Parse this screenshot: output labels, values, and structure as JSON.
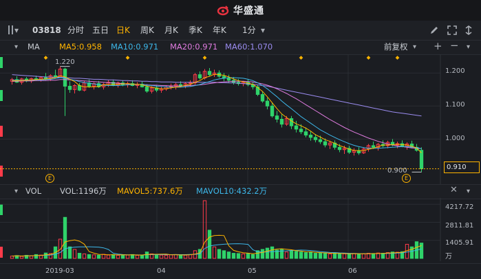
{
  "app": {
    "logo_text": "华盛通"
  },
  "toolbar": {
    "stock_code": "03818",
    "periods": [
      "分时",
      "五日",
      "日K",
      "周K",
      "月K",
      "季K",
      "年K",
      "1分"
    ],
    "active_period": "日K"
  },
  "main_chart": {
    "label": "MA",
    "ma5": "MA5:0.958",
    "ma10": "MA10:0.971",
    "ma20": "MA20:0.971",
    "ma60": "MA60:1.070",
    "adjust": "前复权",
    "price_ticks": [
      "1.200",
      "1.100",
      "1.000"
    ],
    "current_price": "0.910",
    "high_label": "1.220",
    "low_label": "0.900",
    "event_marker": "E"
  },
  "volume_chart": {
    "label": "VOL",
    "vol": "VOL:1196万",
    "mavol5": "MAVOL5:737.6万",
    "mavol10": "MAVOL10:432.2万",
    "ticks": [
      "4217.72",
      "2811.81",
      "1405.91"
    ],
    "unit": "万"
  },
  "x_axis": {
    "labels": [
      "2019-03",
      "04",
      "05",
      "06"
    ]
  },
  "colors": {
    "up": "#ff3b4a",
    "down": "#2fd36a",
    "ma5": "#ffb400",
    "ma10": "#3db7e9",
    "ma20": "#e07ce0",
    "ma60": "#9b8cf0",
    "accent": "#ffb400"
  },
  "chart_data": {
    "type": "candlestick",
    "ylim": [
      0.88,
      1.24
    ],
    "vol_ylim": [
      0,
      4500
    ],
    "ohlc": [
      [
        1.175,
        1.185,
        1.165,
        1.18
      ],
      [
        1.18,
        1.19,
        1.17,
        1.172
      ],
      [
        1.172,
        1.185,
        1.165,
        1.182
      ],
      [
        1.182,
        1.188,
        1.172,
        1.176
      ],
      [
        1.176,
        1.186,
        1.17,
        1.183
      ],
      [
        1.183,
        1.192,
        1.176,
        1.18
      ],
      [
        1.18,
        1.19,
        1.174,
        1.186
      ],
      [
        1.186,
        1.2,
        1.178,
        1.182
      ],
      [
        1.182,
        1.196,
        1.176,
        1.192
      ],
      [
        1.192,
        1.21,
        1.185,
        1.188
      ],
      [
        1.188,
        1.22,
        1.185,
        1.212
      ],
      [
        1.212,
        1.216,
        1.07,
        1.16
      ],
      [
        1.16,
        1.175,
        1.14,
        1.15
      ],
      [
        1.15,
        1.166,
        1.138,
        1.162
      ],
      [
        1.162,
        1.17,
        1.145,
        1.148
      ],
      [
        1.148,
        1.176,
        1.144,
        1.17
      ],
      [
        1.17,
        1.18,
        1.155,
        1.16
      ],
      [
        1.16,
        1.172,
        1.15,
        1.168
      ],
      [
        1.168,
        1.176,
        1.155,
        1.158
      ],
      [
        1.158,
        1.17,
        1.15,
        1.165
      ],
      [
        1.165,
        1.178,
        1.158,
        1.172
      ],
      [
        1.172,
        1.18,
        1.16,
        1.163
      ],
      [
        1.163,
        1.174,
        1.156,
        1.17
      ],
      [
        1.17,
        1.178,
        1.16,
        1.164
      ],
      [
        1.164,
        1.174,
        1.156,
        1.168
      ],
      [
        1.168,
        1.178,
        1.16,
        1.162
      ],
      [
        1.162,
        1.172,
        1.154,
        1.166
      ],
      [
        1.166,
        1.174,
        1.156,
        1.158
      ],
      [
        1.158,
        1.166,
        1.14,
        1.145
      ],
      [
        1.145,
        1.16,
        1.138,
        1.155
      ],
      [
        1.155,
        1.162,
        1.142,
        1.148
      ],
      [
        1.148,
        1.158,
        1.14,
        1.152
      ],
      [
        1.152,
        1.162,
        1.146,
        1.158
      ],
      [
        1.158,
        1.168,
        1.15,
        1.16
      ],
      [
        1.16,
        1.17,
        1.15,
        1.165
      ],
      [
        1.165,
        1.175,
        1.158,
        1.162
      ],
      [
        1.162,
        1.172,
        1.154,
        1.168
      ],
      [
        1.168,
        1.178,
        1.16,
        1.17
      ],
      [
        1.17,
        1.2,
        1.165,
        1.195
      ],
      [
        1.195,
        1.205,
        1.18,
        1.185
      ],
      [
        1.185,
        1.212,
        1.18,
        1.205
      ],
      [
        1.205,
        1.215,
        1.19,
        1.195
      ],
      [
        1.195,
        1.21,
        1.188,
        1.2
      ],
      [
        1.2,
        1.208,
        1.185,
        1.19
      ],
      [
        1.19,
        1.2,
        1.175,
        1.185
      ],
      [
        1.185,
        1.195,
        1.17,
        1.178
      ],
      [
        1.178,
        1.188,
        1.165,
        1.172
      ],
      [
        1.172,
        1.182,
        1.162,
        1.168
      ],
      [
        1.168,
        1.176,
        1.16,
        1.172
      ],
      [
        1.172,
        1.18,
        1.16,
        1.165
      ],
      [
        1.165,
        1.172,
        1.15,
        1.158
      ],
      [
        1.158,
        1.165,
        1.13,
        1.135
      ],
      [
        1.135,
        1.145,
        1.11,
        1.115
      ],
      [
        1.115,
        1.125,
        1.09,
        1.1
      ],
      [
        1.1,
        1.11,
        1.065,
        1.07
      ],
      [
        1.07,
        1.085,
        1.05,
        1.06
      ],
      [
        1.06,
        1.075,
        1.035,
        1.045
      ],
      [
        1.045,
        1.07,
        1.04,
        1.062
      ],
      [
        1.062,
        1.07,
        1.03,
        1.04
      ],
      [
        1.04,
        1.055,
        1.02,
        1.03
      ],
      [
        1.03,
        1.045,
        1.015,
        1.022
      ],
      [
        1.022,
        1.035,
        1.005,
        1.012
      ],
      [
        1.012,
        1.025,
        0.995,
        1.005
      ],
      [
        1.005,
        1.015,
        0.99,
        0.998
      ],
      [
        0.998,
        1.01,
        0.985,
        0.992
      ],
      [
        0.992,
        1.002,
        0.975,
        0.982
      ],
      [
        0.982,
        0.995,
        0.97,
        0.988
      ],
      [
        0.988,
        0.996,
        0.968,
        0.975
      ],
      [
        0.975,
        0.985,
        0.96,
        0.968
      ],
      [
        0.968,
        0.98,
        0.955,
        0.972
      ],
      [
        0.972,
        0.98,
        0.955,
        0.96
      ],
      [
        0.96,
        0.972,
        0.95,
        0.965
      ],
      [
        0.965,
        0.975,
        0.952,
        0.958
      ],
      [
        0.958,
        0.975,
        0.955,
        0.97
      ],
      [
        0.97,
        0.985,
        0.962,
        0.98
      ],
      [
        0.98,
        0.992,
        0.97,
        0.975
      ],
      [
        0.975,
        0.988,
        0.965,
        0.984
      ],
      [
        0.984,
        0.996,
        0.975,
        0.98
      ],
      [
        0.98,
        0.995,
        0.972,
        0.99
      ],
      [
        0.99,
        1.0,
        0.978,
        0.982
      ],
      [
        0.982,
        0.992,
        0.972,
        0.986
      ],
      [
        0.986,
        0.996,
        0.975,
        0.978
      ],
      [
        0.978,
        0.99,
        0.968,
        0.985
      ],
      [
        0.985,
        0.995,
        0.972,
        0.975
      ],
      [
        0.975,
        0.985,
        0.962,
        0.966
      ],
      [
        0.966,
        0.975,
        0.9,
        0.91
      ]
    ],
    "volumes": [
      180,
      220,
      160,
      240,
      200,
      300,
      260,
      420,
      380,
      900,
      1500,
      3200,
      900,
      700,
      400,
      350,
      300,
      280,
      250,
      320,
      260,
      300,
      240,
      280,
      260,
      300,
      240,
      220,
      500,
      350,
      300,
      260,
      240,
      280,
      300,
      260,
      250,
      300,
      600,
      700,
      4500,
      2200,
      900,
      700,
      600,
      500,
      400,
      380,
      350,
      400,
      300,
      600,
      700,
      800,
      900,
      650,
      700,
      500,
      600,
      550,
      500,
      450,
      480,
      400,
      420,
      380,
      350,
      400,
      380,
      360,
      340,
      380,
      360,
      350,
      400,
      380,
      420,
      400,
      450,
      500,
      480,
      520,
      1100,
      900,
      1300,
      1196
    ],
    "ma5": [
      1.176,
      1.177,
      1.177,
      1.178,
      1.179,
      1.18,
      1.181,
      1.182,
      1.184,
      1.186,
      1.192,
      1.188,
      1.181,
      1.174,
      1.162,
      1.158,
      1.158,
      1.158,
      1.159,
      1.164,
      1.165,
      1.165,
      1.166,
      1.167,
      1.168,
      1.166,
      1.166,
      1.164,
      1.16,
      1.157,
      1.154,
      1.152,
      1.152,
      1.155,
      1.157,
      1.159,
      1.163,
      1.165,
      1.172,
      1.177,
      1.186,
      1.19,
      1.196,
      1.195,
      1.193,
      1.188,
      1.182,
      1.177,
      1.173,
      1.169,
      1.166,
      1.156,
      1.144,
      1.128,
      1.11,
      1.092,
      1.076,
      1.065,
      1.055,
      1.046,
      1.04,
      1.033,
      1.024,
      1.013,
      1.006,
      0.998,
      0.993,
      0.987,
      0.98,
      0.975,
      0.969,
      0.966,
      0.965,
      0.965,
      0.969,
      0.972,
      0.977,
      0.982,
      0.982,
      0.983,
      0.984,
      0.983,
      0.982,
      0.978,
      0.973,
      0.958
    ],
    "ma10": [
      1.178,
      1.178,
      1.178,
      1.178,
      1.178,
      1.179,
      1.179,
      1.18,
      1.181,
      1.183,
      1.186,
      1.184,
      1.181,
      1.178,
      1.174,
      1.171,
      1.169,
      1.167,
      1.165,
      1.163,
      1.162,
      1.162,
      1.162,
      1.163,
      1.164,
      1.165,
      1.165,
      1.165,
      1.163,
      1.162,
      1.16,
      1.159,
      1.158,
      1.157,
      1.157,
      1.157,
      1.158,
      1.159,
      1.162,
      1.165,
      1.17,
      1.174,
      1.179,
      1.182,
      1.184,
      1.186,
      1.186,
      1.185,
      1.184,
      1.181,
      1.177,
      1.17,
      1.162,
      1.152,
      1.14,
      1.128,
      1.115,
      1.103,
      1.092,
      1.08,
      1.068,
      1.058,
      1.048,
      1.038,
      1.028,
      1.02,
      1.012,
      1.005,
      0.998,
      0.992,
      0.986,
      0.981,
      0.977,
      0.974,
      0.972,
      0.972,
      0.972,
      0.973,
      0.974,
      0.975,
      0.976,
      0.977,
      0.977,
      0.976,
      0.974,
      0.971
    ],
    "ma20": [
      1.175,
      1.175,
      1.176,
      1.176,
      1.176,
      1.177,
      1.177,
      1.177,
      1.178,
      1.178,
      1.18,
      1.18,
      1.179,
      1.178,
      1.177,
      1.176,
      1.175,
      1.174,
      1.173,
      1.172,
      1.171,
      1.17,
      1.169,
      1.168,
      1.167,
      1.166,
      1.165,
      1.165,
      1.164,
      1.163,
      1.163,
      1.162,
      1.162,
      1.161,
      1.161,
      1.161,
      1.161,
      1.162,
      1.163,
      1.164,
      1.166,
      1.168,
      1.17,
      1.172,
      1.173,
      1.174,
      1.175,
      1.175,
      1.175,
      1.174,
      1.173,
      1.17,
      1.167,
      1.163,
      1.158,
      1.152,
      1.145,
      1.138,
      1.13,
      1.122,
      1.113,
      1.104,
      1.095,
      1.086,
      1.077,
      1.068,
      1.059,
      1.051,
      1.043,
      1.035,
      1.028,
      1.021,
      1.015,
      1.009,
      1.003,
      0.998,
      0.993,
      0.989,
      0.985,
      0.982,
      0.979,
      0.977,
      0.975,
      0.973,
      0.972,
      0.971
    ],
    "ma60": [
      1.195,
      1.194,
      1.193,
      1.192,
      1.191,
      1.19,
      1.189,
      1.188,
      1.188,
      1.187,
      1.187,
      1.186,
      1.185,
      1.184,
      1.184,
      1.183,
      1.182,
      1.181,
      1.181,
      1.18,
      1.179,
      1.179,
      1.178,
      1.177,
      1.177,
      1.176,
      1.176,
      1.175,
      1.175,
      1.174,
      1.174,
      1.173,
      1.173,
      1.173,
      1.172,
      1.172,
      1.172,
      1.172,
      1.172,
      1.172,
      1.172,
      1.172,
      1.172,
      1.171,
      1.171,
      1.17,
      1.17,
      1.169,
      1.168,
      1.167,
      1.166,
      1.164,
      1.162,
      1.16,
      1.157,
      1.154,
      1.151,
      1.148,
      1.145,
      1.142,
      1.139,
      1.136,
      1.133,
      1.13,
      1.127,
      1.124,
      1.121,
      1.118,
      1.115,
      1.112,
      1.109,
      1.106,
      1.103,
      1.1,
      1.097,
      1.094,
      1.091,
      1.088,
      1.085,
      1.082,
      1.08,
      1.078,
      1.076,
      1.074,
      1.072,
      1.07
    ]
  }
}
